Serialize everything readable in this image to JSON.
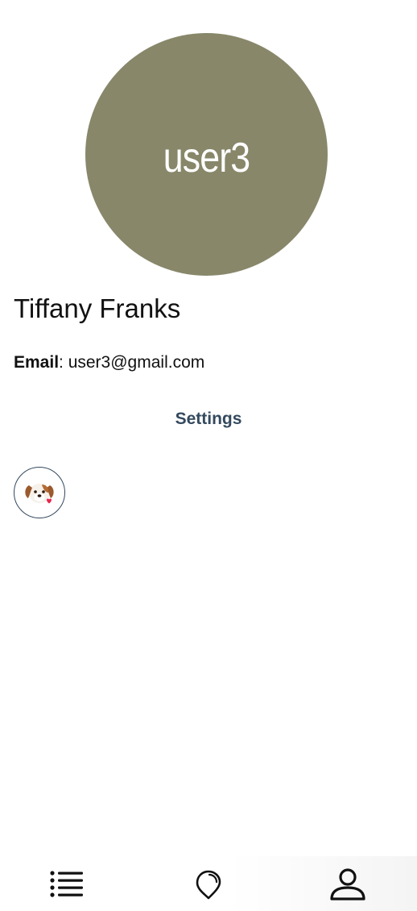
{
  "profile": {
    "avatar_initials": "user3",
    "avatar_color": "#88876a",
    "full_name": "Tiffany Franks",
    "email_label": "Email",
    "email_separator": ": ",
    "email_value": "user3@gmail.com"
  },
  "settings": {
    "label": "Settings",
    "color": "#34495e"
  },
  "pets": [
    {
      "icon": "dog-face-icon"
    }
  ],
  "bottom_nav": {
    "items": [
      {
        "icon": "list-icon"
      },
      {
        "icon": "map-pin-icon"
      },
      {
        "icon": "user-icon",
        "active": true
      }
    ]
  }
}
